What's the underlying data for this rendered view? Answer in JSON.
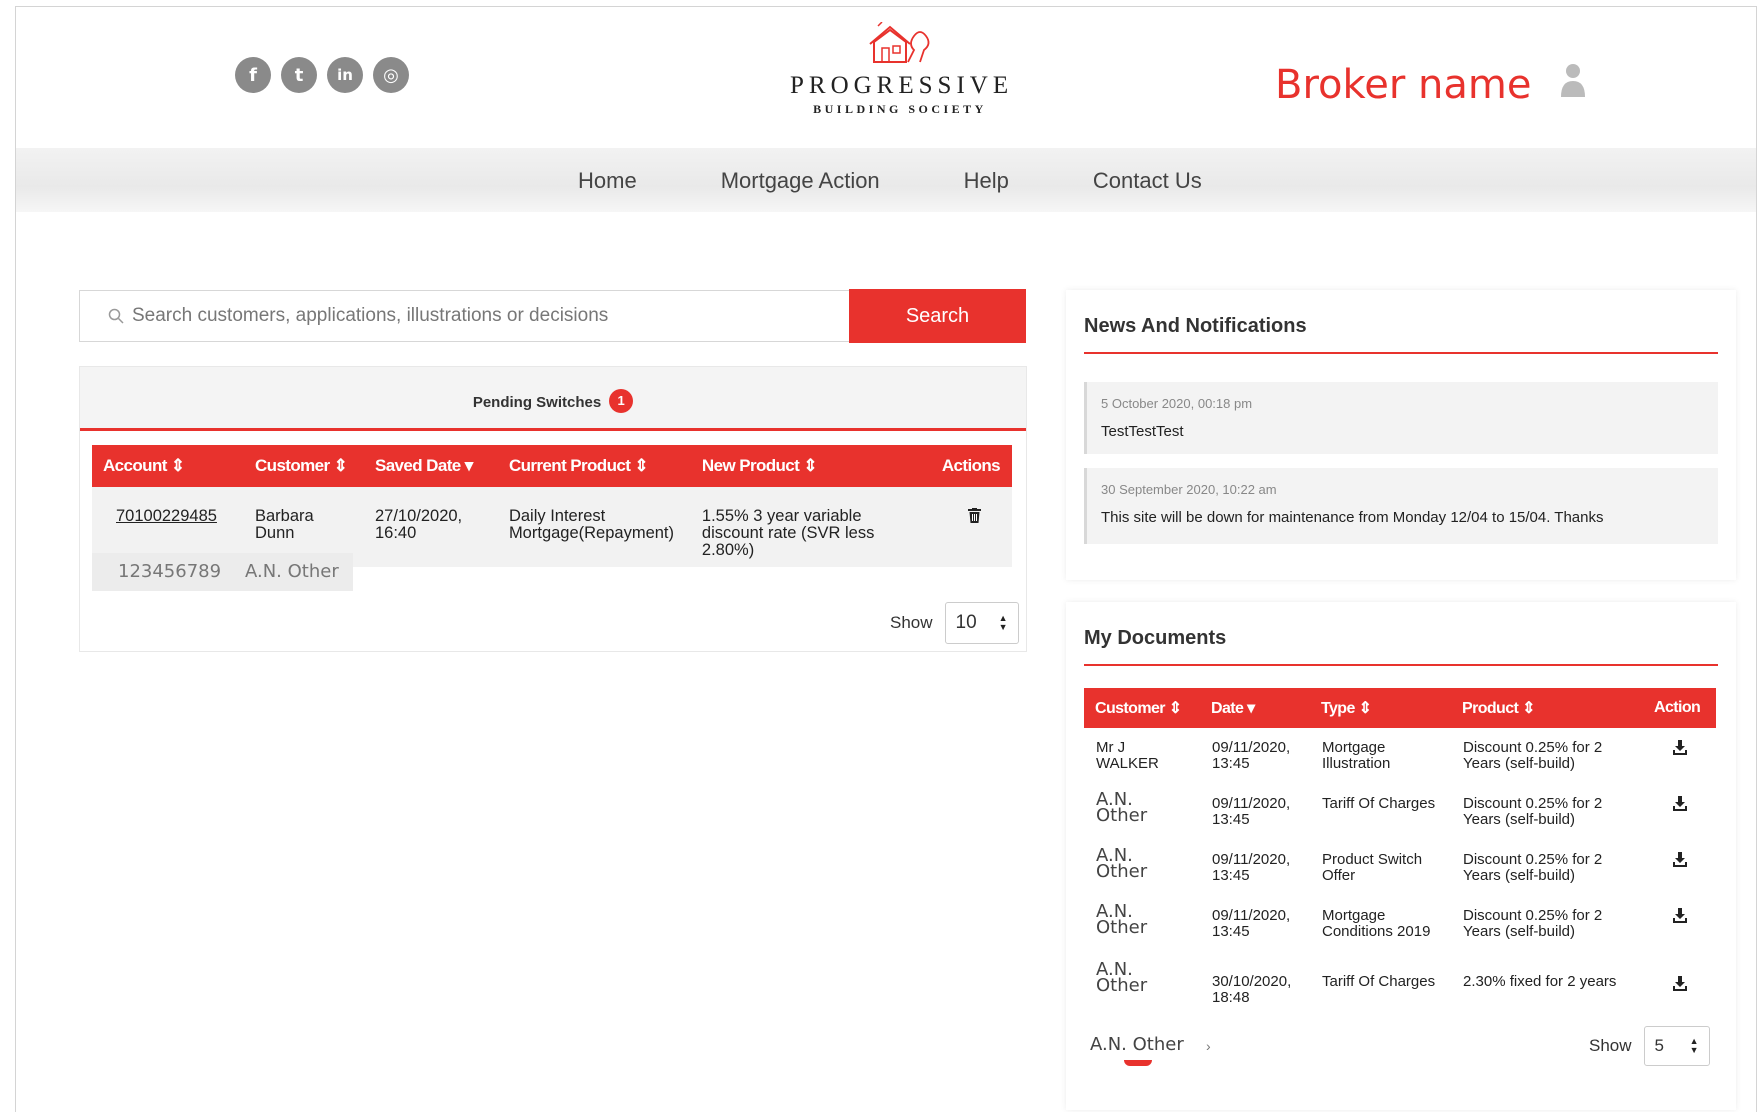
{
  "header": {
    "social": [
      {
        "name": "facebook-icon",
        "glyph": "f"
      },
      {
        "name": "twitter-icon",
        "glyph": "t"
      },
      {
        "name": "linkedin-icon",
        "glyph": "in"
      },
      {
        "name": "instagram-icon",
        "glyph": "◎"
      }
    ],
    "logo_name": "PROGRESSIVE",
    "logo_sub": "BUILDING SOCIETY",
    "broker_name": "Broker name"
  },
  "nav": {
    "items": [
      "Home",
      "Mortgage Action",
      "Help",
      "Contact Us"
    ]
  },
  "search": {
    "placeholder": "Search customers, applications, illustrations or decisions",
    "button_label": "Search"
  },
  "pending": {
    "title": "Pending Switches",
    "count": "1",
    "columns": [
      "Account ⇕",
      "Customer ⇕",
      "Saved Date ▾",
      "Current Product ⇕",
      "New Product ⇕",
      "Actions"
    ],
    "row": {
      "account": "70100229485",
      "customer": "Barbara Dunn",
      "saved_date": "27/10/2020, 16:40",
      "current_product": "Daily Interest Mortgage(Repayment)",
      "new_product": "1.55% 3 year variable discount rate (SVR less 2.80%)"
    },
    "placeholder_account": "123456789",
    "placeholder_customer": "A.N. Other",
    "show_label": "Show",
    "show_value": "10"
  },
  "news": {
    "title": "News And Notifications",
    "items": [
      {
        "date": "5 October 2020, 00:18 pm",
        "message": "TestTestTest"
      },
      {
        "date": "30 September 2020, 10:22 am",
        "message": "This site will be down for maintenance from Monday 12/04 to 15/04. Thanks"
      }
    ]
  },
  "documents": {
    "title": "My Documents",
    "columns": [
      "Customer ⇕",
      "Date ▾",
      "Type ⇕",
      "Product ⇕",
      "Action"
    ],
    "rows": [
      {
        "customer": "Mr J WALKER",
        "date": "09/11/2020, 13:45",
        "type": "Mortgage Illustration",
        "product": "Discount 0.25% for 2 Years (self-build)"
      },
      {
        "customer": "A.N. Other",
        "date": "09/11/2020, 13:45",
        "type": "Tariff Of Charges",
        "product": "Discount 0.25% for 2 Years (self-build)"
      },
      {
        "customer": "A.N. Other",
        "date": "09/11/2020, 13:45",
        "type": "Product Switch Offer",
        "product": "Discount 0.25% for 2 Years (self-build)"
      },
      {
        "customer": "A.N. Other",
        "date": "09/11/2020, 13:45",
        "type": "Mortgage Conditions 2019",
        "product": "Discount 0.25% for 2 Years (self-build)"
      },
      {
        "customer": "A.N. Other",
        "date": "30/10/2020, 18:48",
        "type": "Tariff Of Charges",
        "product": "2.30% fixed for 2 years"
      }
    ],
    "trailing_customer": "A.N. Other",
    "pager_glyph": "›",
    "show_label": "Show",
    "show_value": "5"
  },
  "colors": {
    "accent": "#e8322d",
    "nav_bg": "#eeeeee"
  }
}
